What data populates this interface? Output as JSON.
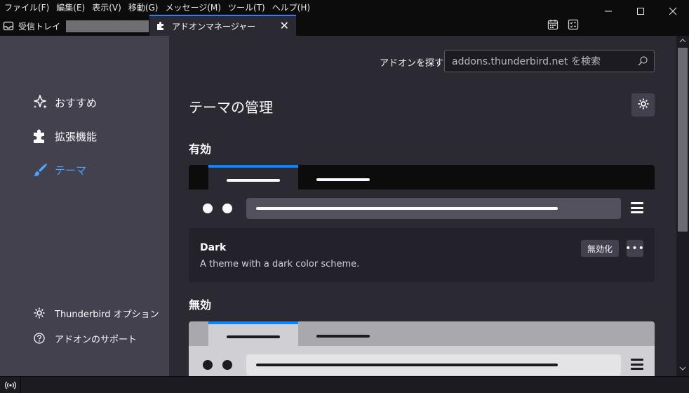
{
  "menubar": {
    "items": [
      "ファイル(F)",
      "編集(E)",
      "表示(V)",
      "移動(G)",
      "メッセージ(M)",
      "ツール(T)",
      "ヘルプ(H)"
    ]
  },
  "window_controls": {
    "minimize": "—",
    "maximize": "☐",
    "close": "✕"
  },
  "tabs": [
    {
      "label": "受信トレイ",
      "icon": "inbox-icon"
    },
    {
      "label": "アドオンマネージャー",
      "icon": "puzzle-icon",
      "close": "✕"
    }
  ],
  "toolbar_icons": [
    "calendar-icon",
    "tasks-icon"
  ],
  "sidebar": {
    "categories": [
      {
        "label": "おすすめ",
        "icon": "sparkle-icon",
        "selected": false
      },
      {
        "label": "拡張機能",
        "icon": "puzzle-icon",
        "selected": false
      },
      {
        "label": "テーマ",
        "icon": "brush-icon",
        "selected": true
      }
    ],
    "footer": [
      {
        "label": "Thunderbird オプション",
        "icon": "gear-icon"
      },
      {
        "label": "アドオンのサポート",
        "icon": "help-icon"
      }
    ]
  },
  "search": {
    "label": "アドオンを探す",
    "placeholder": "addons.thunderbird.net を検索"
  },
  "main": {
    "title": "テーマの管理",
    "enabled_heading": "有効",
    "disabled_heading": "無効",
    "enabled_card": {
      "name": "Dark",
      "description": "A theme with a dark color scheme.",
      "disable_label": "無効化",
      "more_label": "•••"
    }
  },
  "colors": {
    "accent": "#0a84ff",
    "selected_category": "#4da3ff",
    "main_bg": "#2b2a33",
    "sidebar_bg": "#42414d"
  }
}
